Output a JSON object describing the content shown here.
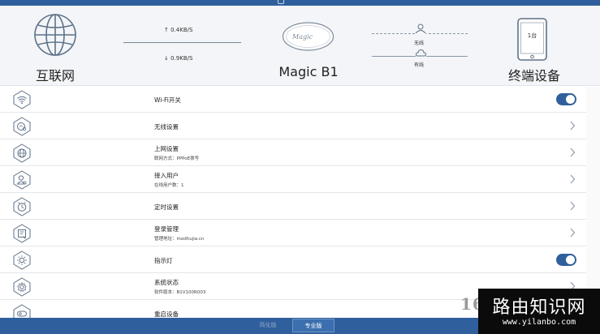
{
  "header": {
    "internet_label": "互联网",
    "upload_speed": "↑ 0.4KB/S",
    "download_speed": "↓ 0.9KB/S",
    "router_logo_text": "Magic",
    "router_name": "Magic B1",
    "wireless_label": "无线",
    "wired_label": "有线",
    "device_count": "1台",
    "devices_label": "终端设备"
  },
  "menu": [
    {
      "icon": "wifi-icon",
      "title": "Wi-Fi开关",
      "subtitle": "",
      "control": "toggle",
      "on": true
    },
    {
      "icon": "wireless-settings-icon",
      "title": "无线设置",
      "subtitle": "",
      "control": "chevron"
    },
    {
      "icon": "internet-settings-icon",
      "title": "上网设置",
      "subtitle": "联网方式：PPPoE拨号",
      "control": "chevron"
    },
    {
      "icon": "users-icon",
      "title": "接入用户",
      "subtitle": "在线用户数：1",
      "control": "chevron"
    },
    {
      "icon": "timer-icon",
      "title": "定时设置",
      "subtitle": "",
      "control": "chevron"
    },
    {
      "icon": "login-management-icon",
      "title": "登录管理",
      "subtitle": "管理地址：modhujia.cn",
      "control": "chevron"
    },
    {
      "icon": "indicator-light-icon",
      "title": "指示灯",
      "subtitle": "",
      "control": "toggle",
      "on": true
    },
    {
      "icon": "system-status-icon",
      "title": "系统状态",
      "subtitle": "软件版本：B1V100R003",
      "control": "chevron"
    },
    {
      "icon": "reboot-icon",
      "title": "重启设备",
      "subtitle": "",
      "control": "chevron"
    }
  ],
  "footer": {
    "simple_tab": "简化版",
    "pro_tab": "专业版"
  },
  "watermark": {
    "partial": "16",
    "site_name": "路由知识网",
    "url": "www.yilanbo.com"
  },
  "colors": {
    "brand_blue": "#2f5f9c",
    "header_bg": "#f3f5f8",
    "divider": "#e2e6ec"
  }
}
